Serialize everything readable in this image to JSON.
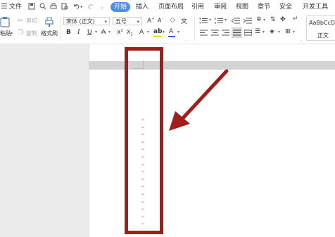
{
  "titlebar": {
    "file_menu": "文件",
    "tabs": [
      "开始",
      "插入",
      "页面布局",
      "引用",
      "审阅",
      "视图",
      "章节",
      "安全",
      "开发工具"
    ],
    "active_tab": "开始"
  },
  "ribbon": {
    "paste_label": "粘贴",
    "cut_label": "剪切",
    "copy_label": "复制",
    "format_painter_label": "格式刷",
    "font_name": "宋体 (正文)",
    "font_size": "五号",
    "style_preview": "AaBbCcDd",
    "style_name": "正文"
  },
  "colors": {
    "accent": "#4e8ef7",
    "annotation_red": "#a11f1b",
    "font_color_bar": "#2b5bd7",
    "highlight_bar": "#f4d23c"
  },
  "icons": [
    "menu-icon",
    "save-icon",
    "print-icon",
    "undo-icon",
    "redo-icon",
    "paste-icon",
    "cut-icon",
    "copy-icon",
    "format-painter-icon",
    "bold-icon",
    "italic-icon",
    "underline-icon",
    "bullet-list-icon",
    "numbered-list-icon",
    "align-left-icon",
    "align-center-icon",
    "align-right-icon",
    "justify-icon",
    "paragraph-mark-icon"
  ],
  "document": {
    "paragraph_mark": "↵",
    "paragraph_marks_count": 15
  }
}
